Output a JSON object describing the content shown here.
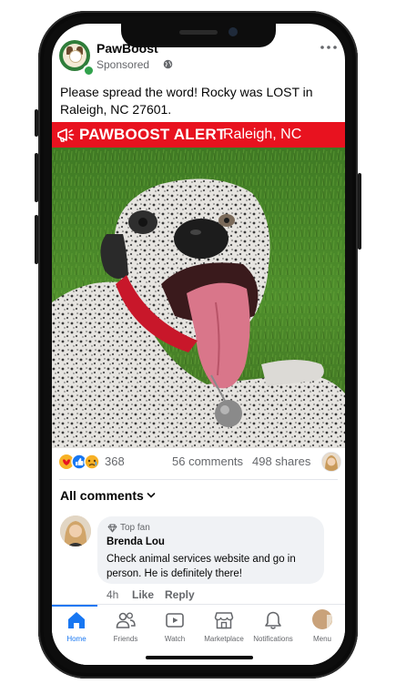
{
  "post": {
    "page_name": "PawBoost",
    "sponsored_label": "Sponsored",
    "text": "Please spread the word! Rocky was LOST in Raleigh, NC 27601."
  },
  "banner": {
    "title": "PAWBOOST ALERT",
    "location": "Raleigh, NC",
    "color": "#e8121f"
  },
  "stats": {
    "reaction_count": "368",
    "comments": "56 comments",
    "shares": "498 shares"
  },
  "comments_section": {
    "header": "All comments",
    "comment": {
      "badge": "Top fan",
      "author": "Brenda Lou",
      "text": "Check animal services website and go in person. He is definitely there!",
      "time": "4h",
      "like_label": "Like",
      "reply_label": "Reply"
    }
  },
  "nav": {
    "home": "Home",
    "friends": "Friends",
    "watch": "Watch",
    "marketplace": "Marketplace",
    "notifications": "Notifications",
    "menu": "Menu",
    "active_color": "#1877f2"
  }
}
